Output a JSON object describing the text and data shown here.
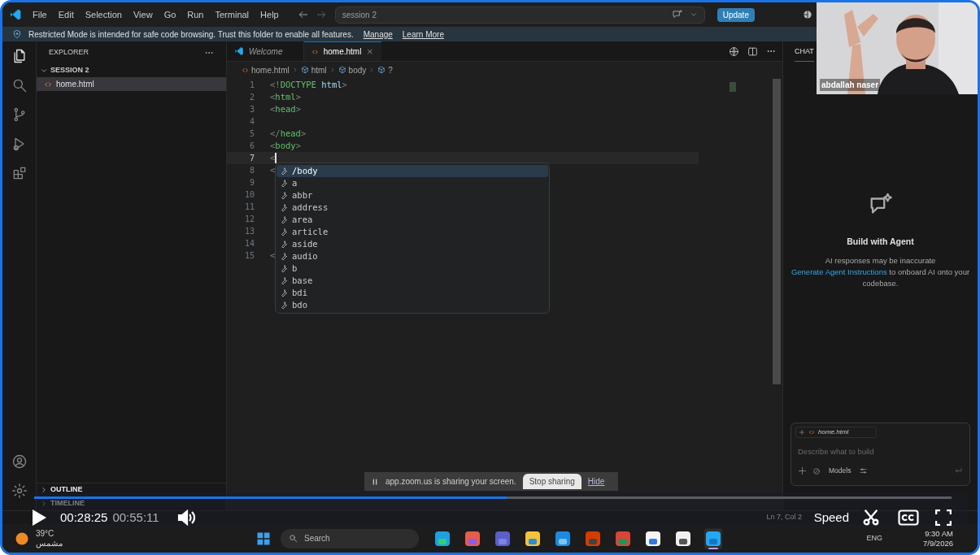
{
  "menu": [
    "File",
    "Edit",
    "Selection",
    "View",
    "Go",
    "Run",
    "Terminal",
    "Help"
  ],
  "command_center": "session 2",
  "update_button": "Update",
  "banner": {
    "message": "Restricted Mode is intended for safe code browsing. Trust this folder to enable all features.",
    "links": [
      "Manage",
      "Learn More"
    ]
  },
  "activity_bar": [
    {
      "kind": "files",
      "selected": true
    },
    {
      "kind": "search",
      "selected": false
    },
    {
      "kind": "source-control",
      "selected": false
    },
    {
      "kind": "run",
      "selected": false
    },
    {
      "kind": "extensions",
      "selected": false
    }
  ],
  "activity_bottom": [
    {
      "kind": "account"
    },
    {
      "kind": "settings"
    }
  ],
  "explorer": {
    "title": "EXPLORER",
    "folder": "SESSION 2",
    "expanded": true,
    "files": [
      {
        "name": "home.html",
        "selected": true
      }
    ],
    "sections": [
      "OUTLINE",
      "TIMELINE"
    ]
  },
  "tabs": [
    {
      "label": "Welcome",
      "kind": "vscode",
      "selected": false
    },
    {
      "label": "home.html",
      "kind": "html",
      "selected": true
    }
  ],
  "breadcrumbs": [
    {
      "label": "home.html",
      "kind": "html"
    },
    {
      "label": "html",
      "kind": "element"
    },
    {
      "label": "body",
      "kind": "element"
    },
    {
      "label": "?",
      "kind": "element"
    }
  ],
  "code": [
    {
      "number": "1",
      "tokens": [
        {
          "kind": "punct",
          "text": "<!"
        },
        {
          "kind": "tag",
          "text": "DOCTYPE"
        },
        {
          "kind": "attr",
          "text": " html"
        },
        {
          "kind": "punct",
          "text": ">"
        }
      ]
    },
    {
      "number": "2",
      "tokens": [
        {
          "kind": "punct",
          "text": "<"
        },
        {
          "kind": "tag",
          "text": "html"
        },
        {
          "kind": "punct",
          "text": ">"
        }
      ]
    },
    {
      "number": "3",
      "tokens": [
        {
          "kind": "punct",
          "text": "<"
        },
        {
          "kind": "tag",
          "text": "head"
        },
        {
          "kind": "punct",
          "text": ">"
        }
      ]
    },
    {
      "number": "4"
    },
    {
      "number": "5",
      "tokens": [
        {
          "kind": "punct",
          "text": "</"
        },
        {
          "kind": "tag",
          "text": "head"
        },
        {
          "kind": "punct",
          "text": ">"
        }
      ]
    },
    {
      "number": "6",
      "tokens": [
        {
          "kind": "punct",
          "text": "<"
        },
        {
          "kind": "tag",
          "text": "body"
        },
        {
          "kind": "punct",
          "text": ">"
        }
      ]
    },
    {
      "number": "7",
      "current": true,
      "tokens": [
        {
          "kind": "punct",
          "text": "<"
        }
      ]
    },
    {
      "number": "8",
      "tokens": [
        {
          "kind": "punct",
          "text": "<"
        }
      ]
    },
    {
      "number": "9"
    },
    {
      "number": "10"
    },
    {
      "number": "11"
    },
    {
      "number": "12"
    },
    {
      "number": "13"
    },
    {
      "number": "14"
    },
    {
      "number": "15",
      "tokens": [
        {
          "kind": "punct",
          "text": "<"
        }
      ]
    }
  ],
  "suggestions": [
    {
      "label": "/body",
      "selected": true
    },
    {
      "label": "a",
      "selected": false
    },
    {
      "label": "abbr",
      "selected": false
    },
    {
      "label": "address",
      "selected": false
    },
    {
      "label": "area",
      "selected": false
    },
    {
      "label": "article",
      "selected": false
    },
    {
      "label": "aside",
      "selected": false
    },
    {
      "label": "audio",
      "selected": false
    },
    {
      "label": "b",
      "selected": false
    },
    {
      "label": "base",
      "selected": false
    },
    {
      "label": "bdi",
      "selected": false
    },
    {
      "label": "bdo",
      "selected": false
    }
  ],
  "chat": {
    "tab": "CHAT",
    "title": "Build with Agent",
    "note": "AI responses may be inaccurate",
    "link": "Generate Agent Instructions",
    "text": " to onboard AI onto your codebase.",
    "attachment": "home.html",
    "placeholder": "Describe what to build",
    "models": "Models"
  },
  "status_bar": {
    "position": "Ln 7, Col 2"
  },
  "webcam": {
    "kind": "picture",
    "name": "abdallah naser"
  },
  "zoom_share": {
    "message": "app.zoom.us is sharing your screen.",
    "stop": "Stop sharing",
    "hide": "Hide"
  },
  "player": {
    "level": 0.515,
    "current": "00:28:25",
    "duration": "00:55:11",
    "speed": "Speed"
  },
  "taskbar": {
    "temperature": "39°C",
    "weather": "مشمس",
    "search": "Search",
    "language": "ENG",
    "time": "9:30 AM",
    "date": "7/9/2026",
    "apps": [
      {
        "kind": "edge",
        "selected": false
      },
      {
        "kind": "copilot",
        "selected": false
      },
      {
        "kind": "teams",
        "selected": false
      },
      {
        "kind": "files",
        "selected": false
      },
      {
        "kind": "mail",
        "selected": false
      },
      {
        "kind": "office",
        "selected": false
      },
      {
        "kind": "chrome",
        "selected": false
      },
      {
        "kind": "store",
        "selected": false
      },
      {
        "kind": "window",
        "selected": false
      },
      {
        "kind": "vscode",
        "selected": true
      }
    ]
  }
}
